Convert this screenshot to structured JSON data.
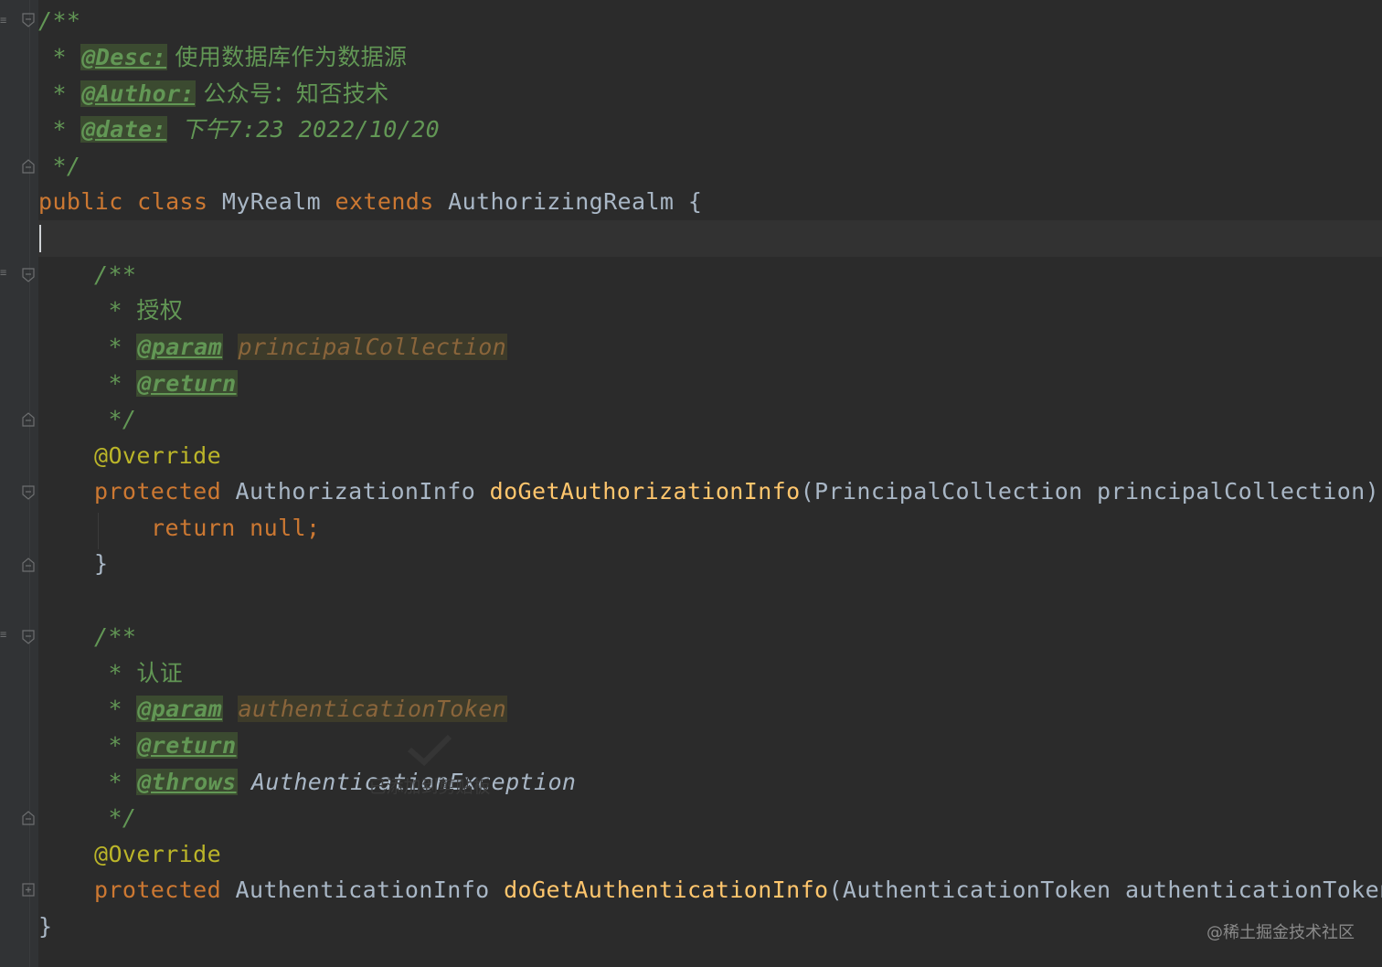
{
  "code": {
    "l1_open": "/**",
    "desc_star": " * ",
    "desc_tag": "@Desc:",
    "desc_text": " 使用数据库作为数据源",
    "author_tag": "@Author:",
    "author_text": " 公众号：知否技术",
    "date_tag": "@date:",
    "date_text": " 下午7:23 2022/10/20",
    "close": " */",
    "class_kw_public": "public",
    "class_kw_class": "class",
    "class_name": "MyRealm",
    "class_kw_extends": "extends",
    "class_parent": "AuthorizingRealm",
    "brace_open": "{",
    "m1_doc_open": "/**",
    "m1_doc_title": "授权",
    "m1_param_tag": "@param",
    "m1_param_name": "principalCollection",
    "m1_return_tag": "@return",
    "doc_close": "*/",
    "override": "@Override",
    "m1_kw": "protected",
    "m1_type": "AuthorizationInfo",
    "m1_name": "doGetAuthorizationInfo",
    "m1_args": "(PrincipalCollection principalCollection) {",
    "m1_return_kw": "return",
    "m1_return_val": "null;",
    "m1_close": "}",
    "m2_doc_open": "/**",
    "m2_doc_title": "认证",
    "m2_param_tag": "@param",
    "m2_param_name": "authenticationToken",
    "m2_return_tag": "@return",
    "m2_throws_tag": "@throws",
    "m2_throws_type": "AuthenticationException",
    "m2_kw": "protected",
    "m2_type": "AuthenticationInfo",
    "m2_name": "doGetAuthenticationInfo",
    "m2_args": "(AuthenticationToken authenticationToken)",
    "class_close": "}"
  },
  "toast": "已添加到剪贴板",
  "watermark": "@稀土掘金技术社区",
  "colors": {
    "background": "#2b2b2b",
    "keyword": "#cc7832",
    "method": "#ffc66d",
    "annotation": "#bbb529",
    "doc_comment": "#629755"
  }
}
